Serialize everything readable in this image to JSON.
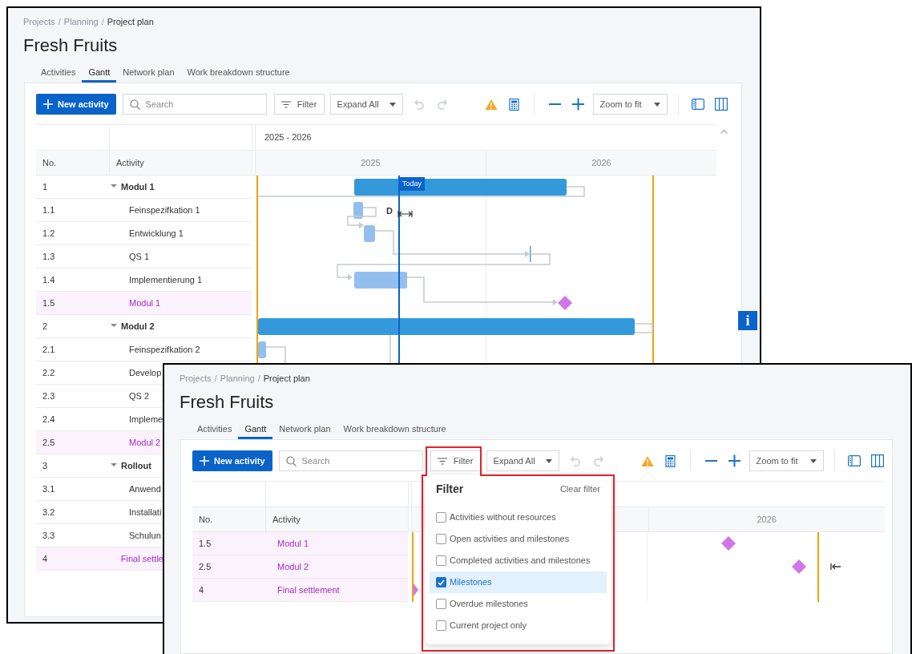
{
  "windows": [
    {
      "breadcrumb": [
        "Projects",
        "Planning",
        "Project plan"
      ],
      "breadcrumb_separator": "/",
      "title": "Fresh Fruits",
      "tabs": [
        {
          "label": "Activities",
          "selected": false
        },
        {
          "label": "Gantt",
          "selected": true
        },
        {
          "label": "Network plan",
          "selected": false
        },
        {
          "label": "Work breakdown structure",
          "selected": false
        }
      ],
      "toolbar": {
        "new_activity": "New activity",
        "search_placeholder": "Search",
        "filter": "Filter",
        "expand": "Expand All",
        "zoom": "Zoom to fit"
      },
      "timeline": {
        "range": "2025 - 2026",
        "years": [
          "2025",
          "2026"
        ]
      },
      "columns": [
        "No.",
        "Activity"
      ],
      "rows": [
        {
          "no": "1",
          "activity": "Modul 1",
          "kind": "summary",
          "expanded": true,
          "children": [
            {
              "no": "1.1",
              "activity": "Feinspezifkation 1",
              "kind": "task"
            },
            {
              "no": "1.2",
              "activity": "Entwicklung 1",
              "kind": "task"
            },
            {
              "no": "1.3",
              "activity": "QS 1",
              "kind": "task"
            },
            {
              "no": "1.4",
              "activity": "Implementierung 1",
              "kind": "task"
            },
            {
              "no": "1.5",
              "activity": "Modul 1",
              "kind": "milestone"
            }
          ]
        },
        {
          "no": "2",
          "activity": "Modul 2",
          "kind": "summary",
          "expanded": true,
          "children": [
            {
              "no": "2.1",
              "activity": "Feinspezifkation 2",
              "kind": "task"
            },
            {
              "no": "2.2",
              "activity": "Develop",
              "kind": "task"
            },
            {
              "no": "2.3",
              "activity": "QS 2",
              "kind": "task"
            },
            {
              "no": "2.4",
              "activity": "Impleme",
              "kind": "task"
            },
            {
              "no": "2.5",
              "activity": "Modul 2",
              "kind": "milestone"
            }
          ]
        },
        {
          "no": "3",
          "activity": "Rollout",
          "kind": "summary",
          "expanded": true,
          "children": [
            {
              "no": "3.1",
              "activity": "Anwend",
              "kind": "task"
            },
            {
              "no": "3.2",
              "activity": "Installati",
              "kind": "task"
            },
            {
              "no": "3.3",
              "activity": "Schulun",
              "kind": "task"
            }
          ]
        },
        {
          "no": "4",
          "activity": "Final settle",
          "kind": "milestone"
        }
      ],
      "today_label": "Today",
      "bar_label": "D",
      "info_button": "i"
    },
    {
      "breadcrumb": [
        "Projects",
        "Planning",
        "Project plan"
      ],
      "breadcrumb_separator": "/",
      "title": "Fresh Fruits",
      "tabs": [
        {
          "label": "Activities",
          "selected": false
        },
        {
          "label": "Gantt",
          "selected": true
        },
        {
          "label": "Network plan",
          "selected": false
        },
        {
          "label": "Work breakdown structure",
          "selected": false
        }
      ],
      "toolbar": {
        "new_activity": "New activity",
        "search_placeholder": "Search",
        "filter": "Filter",
        "expand": "Expand All",
        "zoom": "Zoom to fit"
      },
      "timeline": {
        "years": [
          "2026"
        ]
      },
      "columns": [
        "No.",
        "Activity"
      ],
      "rows": [
        {
          "no": "1.5",
          "activity": "Modul 1",
          "kind": "milestone"
        },
        {
          "no": "2.5",
          "activity": "Modul 2",
          "kind": "milestone"
        },
        {
          "no": "4",
          "activity": "Final settlement",
          "kind": "milestone"
        }
      ],
      "filter_menu": {
        "title": "Filter",
        "clear": "Clear filter",
        "options": [
          {
            "label": "Activities without resources",
            "checked": false,
            "selected": false
          },
          {
            "label": "Open activities and milestones",
            "checked": false,
            "selected": false
          },
          {
            "label": "Completed activities and milestones",
            "checked": false,
            "selected": false
          },
          {
            "label": "Milestones",
            "checked": true,
            "selected": true
          },
          {
            "label": "Overdue milestones",
            "checked": false,
            "selected": false
          },
          {
            "label": "Current project only",
            "checked": false,
            "selected": false
          }
        ]
      }
    }
  ]
}
